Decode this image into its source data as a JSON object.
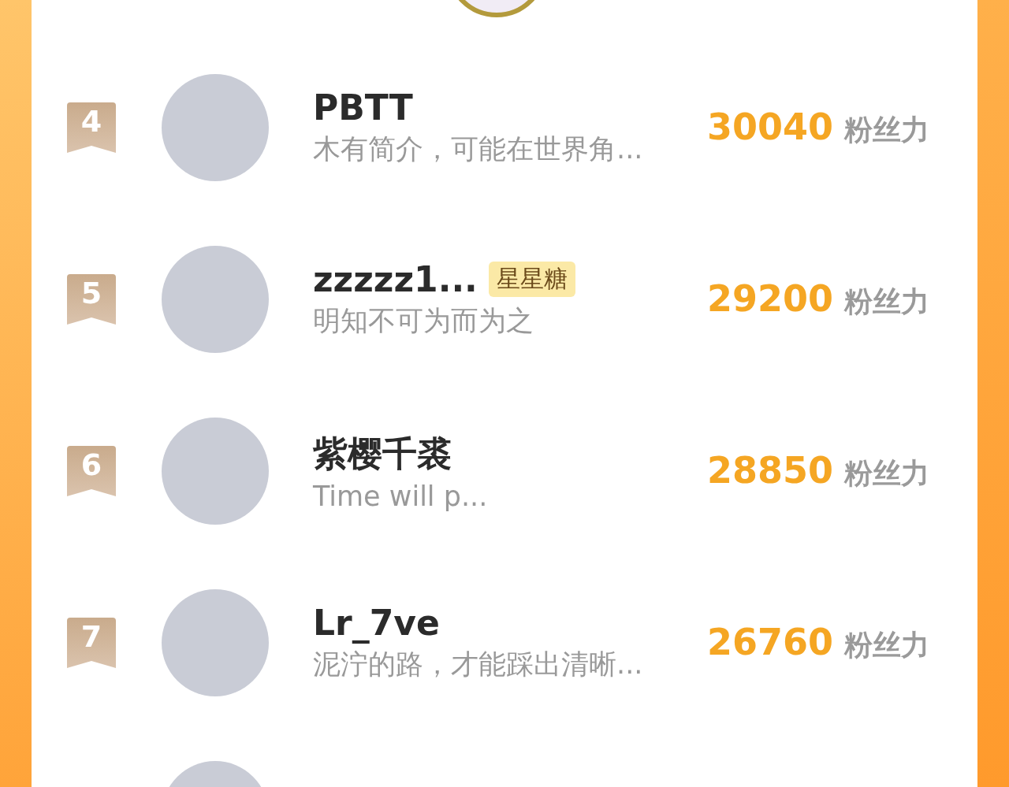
{
  "rows": [
    {
      "rank": "4",
      "name": "PBTT",
      "bio": "木有简介，可能在世界角...",
      "score": "30040",
      "unit": "粉丝力"
    },
    {
      "rank": "5",
      "name": "zzzzz1...",
      "tag": "星星糖",
      "bio": "明知不可为而为之",
      "score": "29200",
      "unit": "粉丝力"
    },
    {
      "rank": "6",
      "name": "紫樱千裘",
      "bio": "Time will p...",
      "score": "28850",
      "unit": "粉丝力"
    },
    {
      "rank": "7",
      "name": "Lr_7ve",
      "bio": "泥泞的路，才能踩出清晰...",
      "score": "26760",
      "unit": "粉丝力"
    }
  ]
}
